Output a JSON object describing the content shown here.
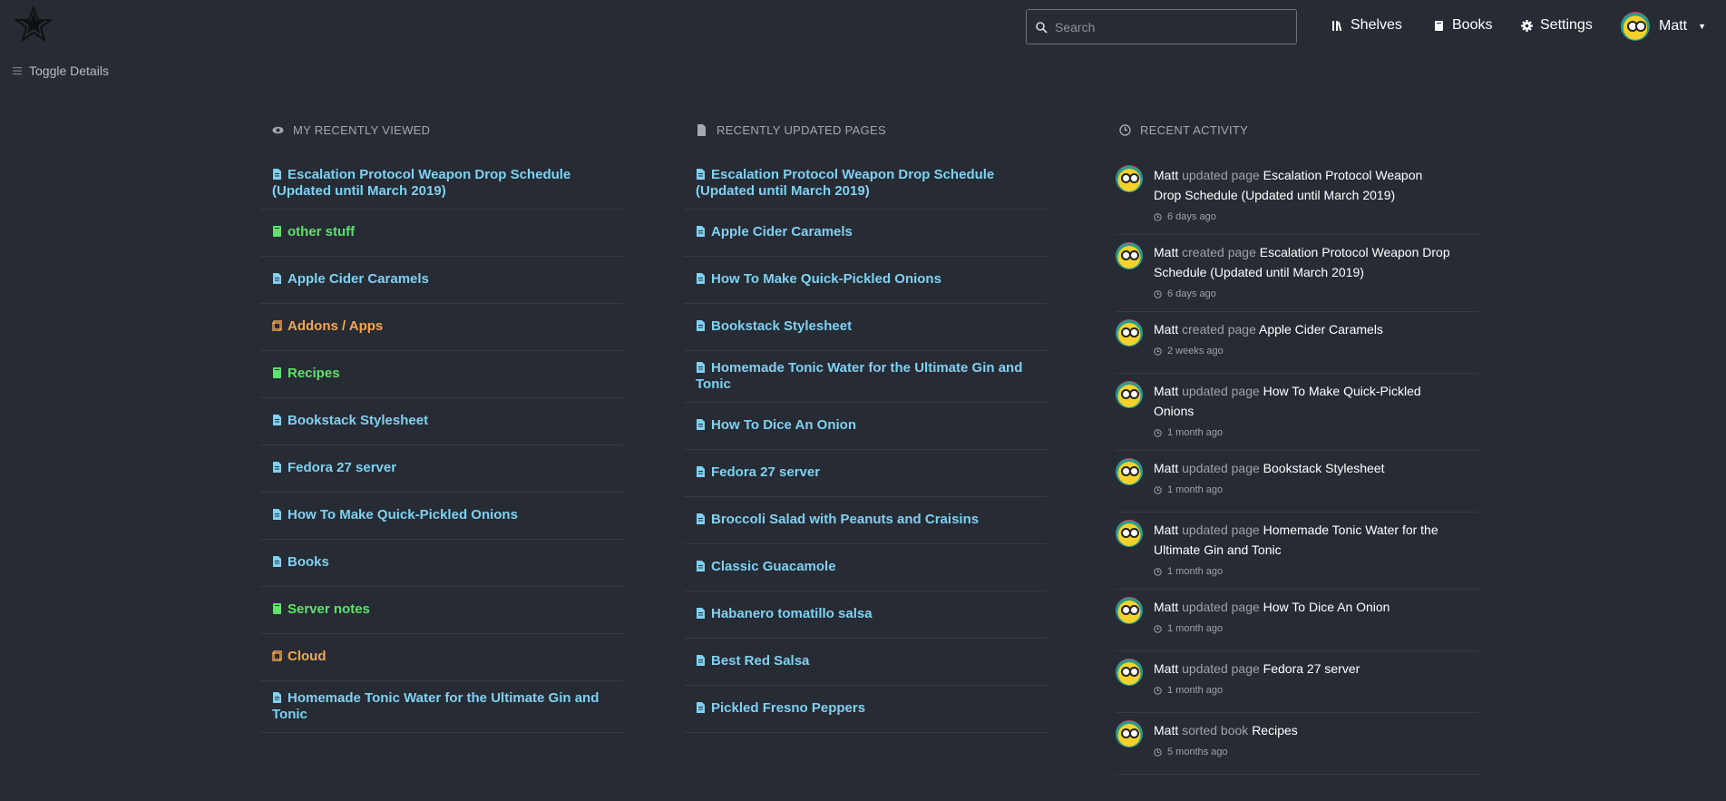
{
  "header": {
    "search_placeholder": "Search",
    "nav": [
      {
        "label": "Shelves",
        "icon": "shelves-icon"
      },
      {
        "label": "Books",
        "icon": "book-icon"
      },
      {
        "label": "Settings",
        "icon": "gear-icon"
      }
    ],
    "user_name": "Matt"
  },
  "toggle_label": "Toggle Details",
  "recently_viewed": {
    "title": "My Recently Viewed",
    "items": [
      {
        "label": "Escalation Protocol Weapon Drop Schedule (Updated until March 2019)",
        "type": "page"
      },
      {
        "label": "other stuff",
        "type": "book"
      },
      {
        "label": "Apple Cider Caramels",
        "type": "page"
      },
      {
        "label": "Addons / Apps",
        "type": "shelf"
      },
      {
        "label": "Recipes",
        "type": "book"
      },
      {
        "label": "Bookstack Stylesheet",
        "type": "page"
      },
      {
        "label": "Fedora 27 server",
        "type": "page"
      },
      {
        "label": "How To Make Quick-Pickled Onions",
        "type": "page"
      },
      {
        "label": "Books",
        "type": "page"
      },
      {
        "label": "Server notes",
        "type": "book"
      },
      {
        "label": "Cloud",
        "type": "shelf"
      },
      {
        "label": "Homemade Tonic Water for the Ultimate Gin and Tonic",
        "type": "page"
      }
    ]
  },
  "recently_updated": {
    "title": "Recently Updated Pages",
    "items": [
      {
        "label": "Escalation Protocol Weapon Drop Schedule (Updated until March 2019)",
        "type": "page"
      },
      {
        "label": "Apple Cider Caramels",
        "type": "page"
      },
      {
        "label": "How To Make Quick-Pickled Onions",
        "type": "page"
      },
      {
        "label": "Bookstack Stylesheet",
        "type": "page"
      },
      {
        "label": "Homemade Tonic Water for the Ultimate Gin and Tonic",
        "type": "page"
      },
      {
        "label": "How To Dice An Onion",
        "type": "page"
      },
      {
        "label": "Fedora 27 server",
        "type": "page"
      },
      {
        "label": "Broccoli Salad with Peanuts and Craisins",
        "type": "page"
      },
      {
        "label": "Classic Guacamole",
        "type": "page"
      },
      {
        "label": "Habanero tomatillo salsa",
        "type": "page"
      },
      {
        "label": "Best Red Salsa",
        "type": "page"
      },
      {
        "label": "Pickled Fresno Peppers",
        "type": "page"
      }
    ]
  },
  "recent_activity": {
    "title": "Recent Activity",
    "items": [
      {
        "user": "Matt",
        "verb": "updated page",
        "target": "Escalation Protocol Weapon Drop Schedule (Updated until March 2019)",
        "time": "6 days ago"
      },
      {
        "user": "Matt",
        "verb": "created page",
        "target": "Escalation Protocol Weapon Drop Schedule (Updated until March 2019)",
        "time": "6 days ago"
      },
      {
        "user": "Matt",
        "verb": "created page",
        "target": "Apple Cider Caramels",
        "time": "2 weeks ago"
      },
      {
        "user": "Matt",
        "verb": "updated page",
        "target": "How To Make Quick-Pickled Onions",
        "time": "1 month ago"
      },
      {
        "user": "Matt",
        "verb": "updated page",
        "target": "Bookstack Stylesheet",
        "time": "1 month ago"
      },
      {
        "user": "Matt",
        "verb": "updated page",
        "target": "Homemade Tonic Water for the Ultimate Gin and Tonic",
        "time": "1 month ago"
      },
      {
        "user": "Matt",
        "verb": "updated page",
        "target": "How To Dice An Onion",
        "time": "1 month ago"
      },
      {
        "user": "Matt",
        "verb": "updated page",
        "target": "Fedora 27 server",
        "time": "1 month ago"
      },
      {
        "user": "Matt",
        "verb": "sorted book",
        "target": "Recipes",
        "time": "5 months ago"
      }
    ]
  },
  "colors": {
    "background": "#272b34",
    "page": "#7fd1f2",
    "book": "#5ee36a",
    "shelf": "#f4a652"
  }
}
